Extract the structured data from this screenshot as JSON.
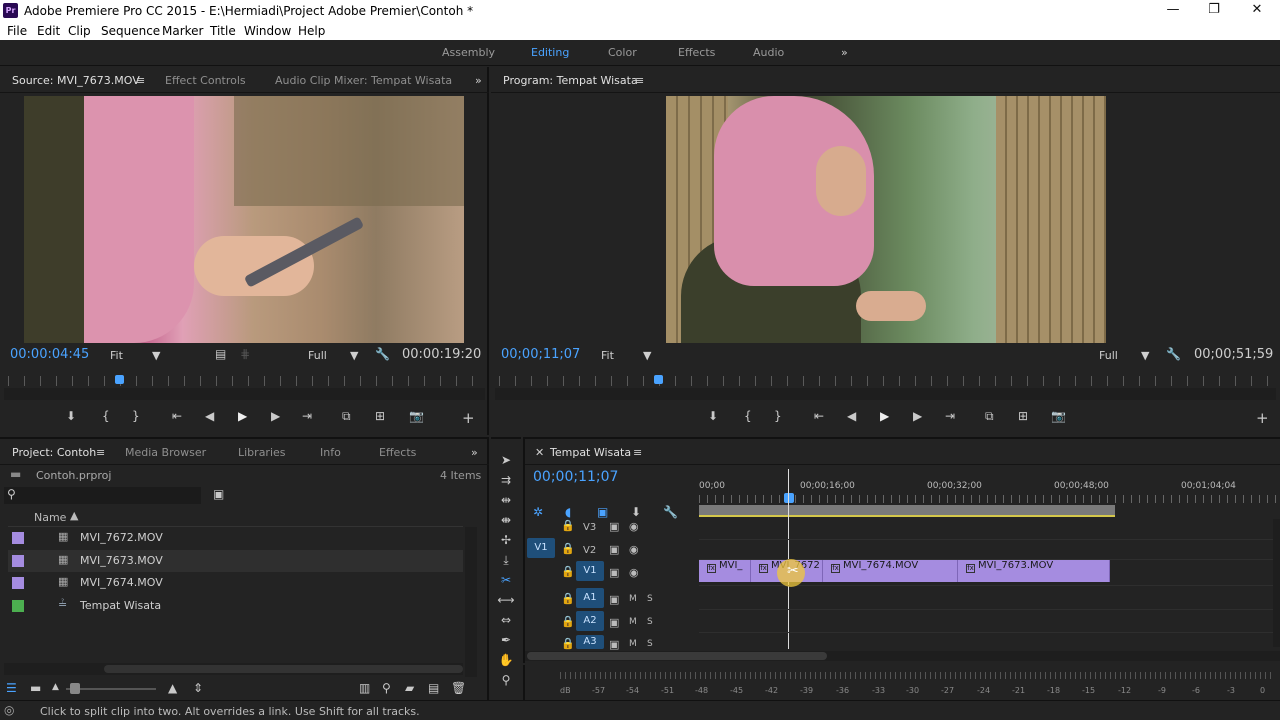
{
  "window": {
    "title": "Adobe Premiere Pro CC 2015 - E:\\Hermiadi\\Project Adobe Premier\\Contoh *",
    "app_icon": "Pr",
    "minimize": "—",
    "restore": "❐",
    "close": "✕"
  },
  "menu": [
    "File",
    "Edit",
    "Clip",
    "Sequence",
    "Marker",
    "Title",
    "Window",
    "Help"
  ],
  "workspaces": {
    "items": [
      "Assembly",
      "Editing",
      "Color",
      "Effects",
      "Audio"
    ],
    "active": "Editing",
    "more": "»"
  },
  "source_panel": {
    "tabs": [
      "Source: MVI_7673.MOV",
      "Effect Controls",
      "Audio Clip Mixer: Tempat Wisata"
    ],
    "timecode_in": "00:00:04:45",
    "fit": "Fit",
    "quality": "Full",
    "timecode_out": "00:00:19:20",
    "playhead": 0.18
  },
  "program_panel": {
    "tab": "Program: Tempat Wisata",
    "timecode_in": "00;00;11;07",
    "fit": "Fit",
    "quality": "Full",
    "timecode_out": "00;00;51;59",
    "playhead": 0.21
  },
  "project_panel": {
    "tabs": [
      "Project: Contoh",
      "Media Browser",
      "Libraries",
      "Info",
      "Effects"
    ],
    "file": "Contoh.prproj",
    "count": "4 Items",
    "column_name": "Name",
    "items": [
      {
        "name": "MVI_7672.MOV",
        "color": "#a58ce0",
        "type": "clip"
      },
      {
        "name": "MVI_7673.MOV",
        "color": "#a58ce0",
        "type": "clip"
      },
      {
        "name": "MVI_7674.MOV",
        "color": "#a58ce0",
        "type": "clip"
      },
      {
        "name": "Tempat Wisata",
        "color": "#4caf50",
        "type": "sequence"
      }
    ]
  },
  "timeline": {
    "tab": "Tempat Wisata",
    "timecode": "00;00;11;07",
    "ruler": [
      "00;00",
      "00;00;16;00",
      "00;00;32;00",
      "00;00;48;00",
      "00;01;04;04"
    ],
    "tracks": [
      {
        "name": "V3",
        "toggles": []
      },
      {
        "name": "V2",
        "toggles": []
      },
      {
        "name": "V1",
        "toggles": []
      },
      {
        "name": "A1",
        "toggles": [
          "M",
          "S"
        ]
      },
      {
        "name": "A2",
        "toggles": [
          "M",
          "S"
        ]
      },
      {
        "name": "A3",
        "toggles": [
          "M",
          "S"
        ]
      }
    ],
    "clips": [
      {
        "label": "MVI_"
      },
      {
        "label": "MVI_7672"
      },
      {
        "label": "MVI_7674.MOV"
      },
      {
        "label": "MVI_7673.MOV"
      }
    ]
  },
  "meter": [
    "dB",
    "-57",
    "-54",
    "-51",
    "-48",
    "-45",
    "-42",
    "-39",
    "-36",
    "-33",
    "-30",
    "-27",
    "-24",
    "-21",
    "-18",
    "-15",
    "-12",
    "-9",
    "-6",
    "-3",
    "0"
  ],
  "status": "Click to split clip into two. Alt overrides a link. Use Shift for all tracks."
}
